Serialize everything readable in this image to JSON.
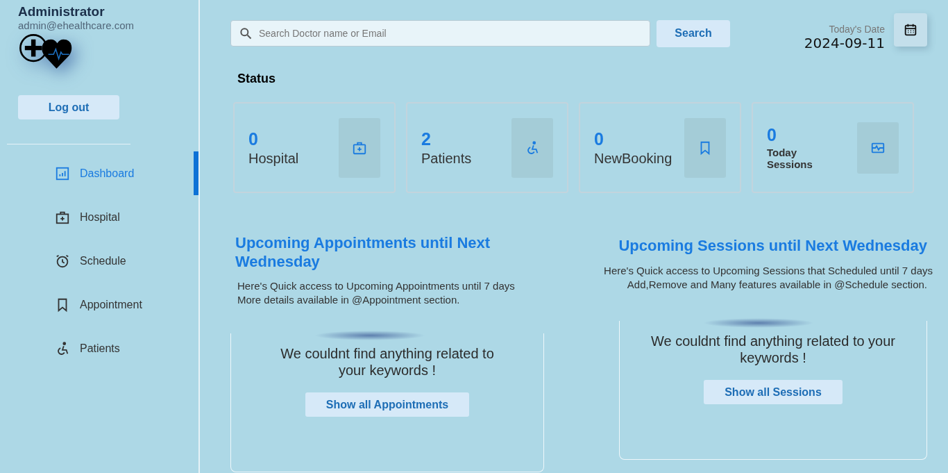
{
  "sidebar": {
    "profile": {
      "name": "Administrator",
      "email": "admin@ehealthcare.com"
    },
    "logout": "Log out",
    "items": [
      {
        "label": "Dashboard",
        "kind": "dashboard",
        "selected": true
      },
      {
        "label": "Hospital",
        "kind": "hospital",
        "selected": false
      },
      {
        "label": "Schedule",
        "kind": "clock",
        "selected": false
      },
      {
        "label": "Appointment",
        "kind": "bookmark",
        "selected": false
      },
      {
        "label": "Patients",
        "kind": "wheelchair",
        "selected": false
      }
    ]
  },
  "search": {
    "placeholder": "Search Doctor name or Email",
    "button": "Search"
  },
  "date": {
    "label": "Today's Date",
    "value": "2024-09-11"
  },
  "status": {
    "title": "Status",
    "cards": [
      {
        "count": "0",
        "label": "Hospital",
        "kind": "hospital"
      },
      {
        "count": "2",
        "label": "Patients",
        "kind": "wheelchair"
      },
      {
        "count": "0",
        "label": "NewBooking",
        "kind": "bookmark"
      },
      {
        "count": "0",
        "label": "Today Sessions",
        "kind": "pulse"
      }
    ]
  },
  "sections": [
    {
      "title": "Upcoming Appointments until Next Wednesday",
      "lines": [
        "Here's Quick access to Upcoming Appointments until 7 days",
        "More details available in @Appointment section."
      ],
      "empty": "We couldnt find anything related to your keywords !",
      "button": "Show all Appointments"
    },
    {
      "title": "Upcoming Sessions until Next Wednesday",
      "lines": [
        "Here's Quick access to Upcoming Sessions that Scheduled until 7 days",
        "Add,Remove and Many features available in @Schedule section."
      ],
      "empty": "We couldnt find anything related to your keywords !",
      "button": "Show all Sessions"
    }
  ]
}
